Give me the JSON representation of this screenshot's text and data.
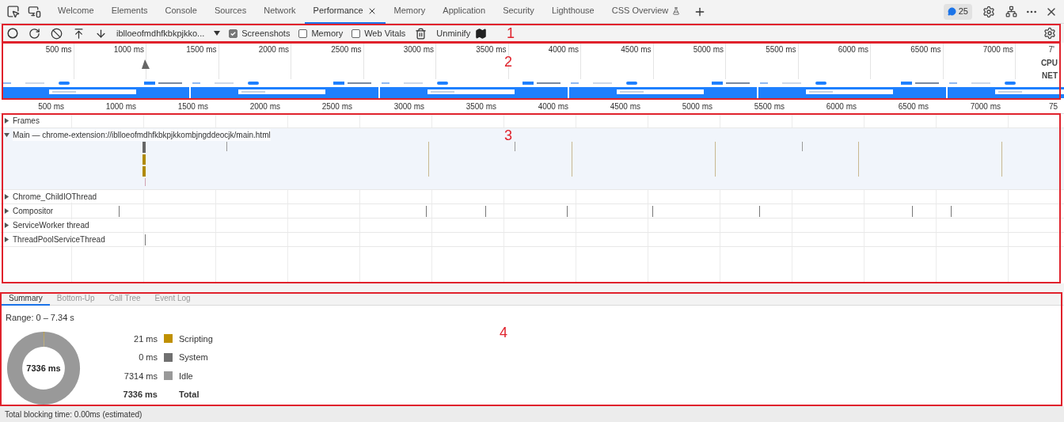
{
  "tabs": [
    {
      "label": "Welcome",
      "selected": false
    },
    {
      "label": "Elements",
      "selected": false
    },
    {
      "label": "Console",
      "selected": false
    },
    {
      "label": "Sources",
      "selected": false
    },
    {
      "label": "Network",
      "selected": false
    },
    {
      "label": "Performance",
      "selected": true,
      "closable": true
    },
    {
      "label": "Memory",
      "selected": false
    },
    {
      "label": "Application",
      "selected": false
    },
    {
      "label": "Security",
      "selected": false
    },
    {
      "label": "Lighthouse",
      "selected": false
    },
    {
      "label": "CSS Overview",
      "selected": false,
      "experimental": true
    }
  ],
  "issues_badge": "25",
  "toolbar": {
    "profile": "iblloeofmdhfkbkpjkko...",
    "checkboxes": [
      {
        "label": "Screenshots",
        "checked": true
      },
      {
        "label": "Memory",
        "checked": false
      },
      {
        "label": "Web Vitals",
        "checked": false
      }
    ],
    "unminify": "Unminify"
  },
  "overview": {
    "ticks": [
      "500 ms",
      "1000 ms",
      "1500 ms",
      "2000 ms",
      "2500 ms",
      "3000 ms",
      "3500 ms",
      "4000 ms",
      "4500 ms",
      "5000 ms",
      "5500 ms",
      "6000 ms",
      "6500 ms",
      "7000 ms",
      "7'"
    ],
    "lanes": [
      "CPU",
      "NET"
    ],
    "screenshots": [
      {
        "kind": "picture"
      },
      {
        "kind": "picture"
      },
      {
        "kind": "picture"
      },
      {
        "kind": "picture"
      },
      {
        "kind": "picture"
      },
      {
        "kind": "picture"
      }
    ]
  },
  "ruler": [
    "500 ms",
    "1000 ms",
    "1500 ms",
    "2000 ms",
    "2500 ms",
    "3000 ms",
    "3500 ms",
    "4000 ms",
    "4500 ms",
    "5000 ms",
    "5500 ms",
    "6000 ms",
    "6500 ms",
    "7000 ms",
    "75"
  ],
  "tracks": [
    {
      "label": "Frames",
      "expanded": false
    },
    {
      "label": "Main — chrome-extension://iblloeofmdhfkbkpjkkombjngddeocjk/main.html",
      "expanded": true
    },
    {
      "label": "Chrome_ChildIOThread",
      "expanded": false
    },
    {
      "label": "Compositor",
      "expanded": false
    },
    {
      "label": "ServiceWorker thread",
      "expanded": false
    },
    {
      "label": "ThreadPoolServiceThread",
      "expanded": false
    }
  ],
  "detail_tabs": [
    {
      "label": "Summary",
      "selected": true
    },
    {
      "label": "Bottom-Up",
      "selected": false
    },
    {
      "label": "Call Tree",
      "selected": false
    },
    {
      "label": "Event Log",
      "selected": false
    }
  ],
  "summary": {
    "range": "Range: 0 – 7.34 s",
    "center": "7336 ms",
    "chart_data": {
      "type": "donut",
      "categories": [
        "Scripting",
        "System",
        "Idle"
      ],
      "series": [
        {
          "values": [
            0.29,
            0,
            99.71
          ]
        }
      ]
    },
    "legend": [
      {
        "value": "21 ms",
        "color": "#c09000"
      },
      {
        "value": "0 ms",
        "color": "#707070"
      },
      {
        "value": "7314 ms",
        "color": "#999999"
      }
    ],
    "total": {
      "value": "7336 ms",
      "label": "Total"
    }
  },
  "status": "Total blocking time: 0.00ms (estimated)",
  "annotations": [
    "1",
    "2",
    "3",
    "4"
  ]
}
